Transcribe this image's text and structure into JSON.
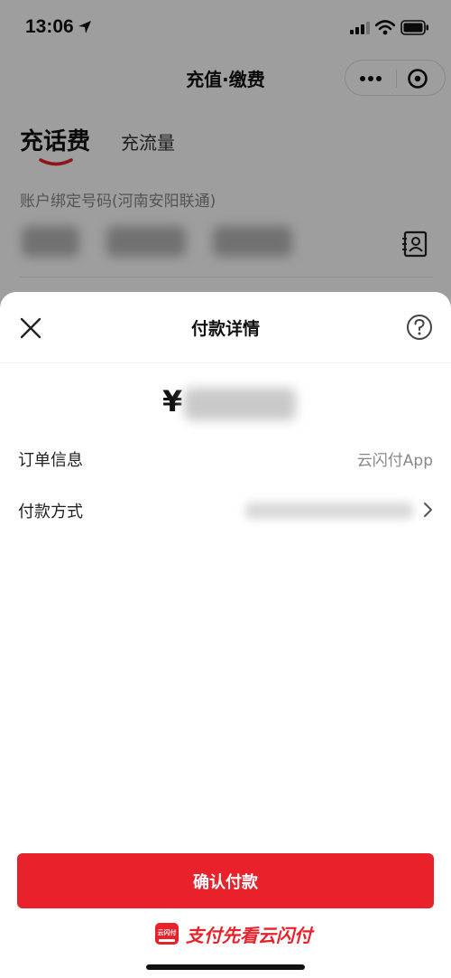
{
  "status_bar": {
    "time": "13:06"
  },
  "navbar": {
    "title": "充值·缴费"
  },
  "tabs": [
    {
      "label": "充话费",
      "active": true
    },
    {
      "label": "充流量",
      "active": false
    }
  ],
  "account": {
    "label": "账户绑定号码(河南安阳联通)"
  },
  "sheet": {
    "title": "付款详情",
    "amount_symbol": "¥",
    "rows": [
      {
        "label": "订单信息",
        "value": "云闪付App"
      },
      {
        "label": "付款方式",
        "value": ""
      }
    ],
    "confirm_label": "确认付款",
    "brand_logo_text": "云闪付",
    "brand_slogan": "支付先看云闪付"
  },
  "colors": {
    "accent": "#e8212b",
    "text": "#111111",
    "muted": "#888888"
  },
  "icons": [
    "location-arrow-icon",
    "signal-icon",
    "wifi-icon",
    "battery-icon",
    "more-icon",
    "close-circle-icon",
    "contact-book-icon",
    "close-icon",
    "help-icon",
    "chevron-right-icon"
  ]
}
